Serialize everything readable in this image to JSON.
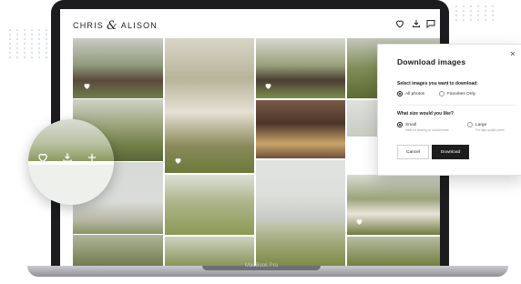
{
  "app": {
    "logo_left": "CHRIS",
    "logo_amp": "&",
    "logo_right": "ALISON",
    "header_icons": [
      "heart-icon",
      "download-icon",
      "comment-icon"
    ]
  },
  "laptop": {
    "brand": "MacBook Pro"
  },
  "zoom_lens": {
    "icons": [
      "heart-icon",
      "download-icon",
      "plus-icon"
    ]
  },
  "download_panel": {
    "title": "Download images",
    "question_images": "Select images you want to download:",
    "option_all": "All photos",
    "option_favorites": "Favorites Only",
    "question_size": "What size would you like?",
    "size_small": "Small",
    "size_small_desc": "Ideal for sharing on social media",
    "size_large": "Large",
    "size_large_desc": "For high-quality prints",
    "cancel_label": "Cancel",
    "download_label": "Download",
    "selected_images": "All photos",
    "selected_size": "Small"
  },
  "colors": {
    "laptop_frame": "#1c1c1e",
    "download_button": "#1d1d1d",
    "accent_text": "#1a1a1a"
  }
}
